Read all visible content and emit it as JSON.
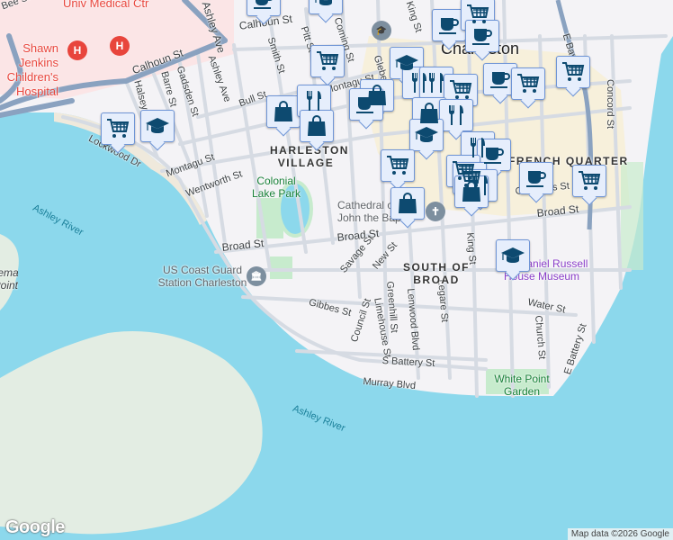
{
  "map": {
    "colors": {
      "water": "#8cd8ec",
      "land": "#f4f3f6",
      "park": "#c7ebcd",
      "hospital": "#fbe5e6",
      "downtown": "#f8efd4",
      "highway": "#8aa2c0",
      "marker_bg": "#e6eefc",
      "marker_icon": "#0d4a70"
    },
    "city_label": "Charleston",
    "districts": [
      "HARLESTON VILLAGE",
      "FRENCH QUARTER",
      "SOUTH OF BROAD"
    ],
    "parks": [
      "Colonial Lake Park",
      "White Point Garden"
    ],
    "water_labels": [
      "Ashley River",
      "Ashley River"
    ],
    "pois": {
      "medical": "Univ Medical Ctr",
      "hospital": "Shawn Jenkins Children's Hospital",
      "cathedral": "Cathedral of St. John the Baptist",
      "coast_guard": "US Coast Guard Station Charleston",
      "museum": "Nathaniel Russell House Museum",
      "albemarle": "Albemarle Point"
    },
    "streets": [
      "Bee St",
      "Calhoun St",
      "Calhoun St",
      "Ashley Ave",
      "Ashley Ave",
      "Smith St",
      "Pitt St",
      "Coming St",
      "Glebe St",
      "King St",
      "Montagu St",
      "Bull St",
      "Halsey St",
      "Barre St",
      "Gadsden St",
      "Lockwood Dr",
      "Montagu St",
      "Wentworth St",
      "Broad St",
      "Broad St",
      "Broad St",
      "Savage St",
      "New St",
      "Chalmers St",
      "King St",
      "Legare St",
      "Lenwood Blvd",
      "Greenhill St",
      "Limehouse St",
      "Council St",
      "Gibbes St",
      "Water St",
      "Church St",
      "E Battery St",
      "S Battery St",
      "Murray Blvd",
      "Concord St",
      "E Bay St"
    ],
    "marker_types": [
      "coffee",
      "shopping-cart",
      "restaurant",
      "shopping-bag",
      "school"
    ]
  },
  "footer": {
    "logo": "Google",
    "attribution": "Map data ©2026 Google"
  }
}
